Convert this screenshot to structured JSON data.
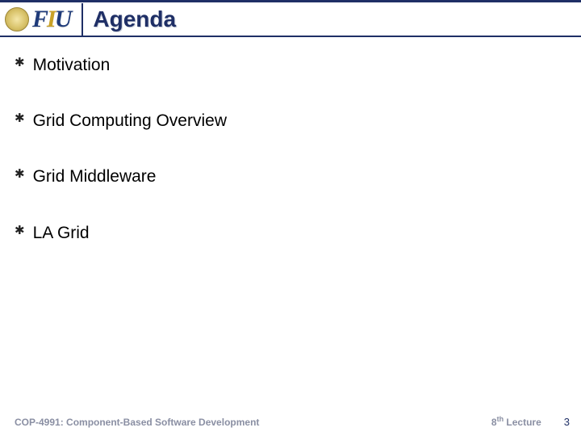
{
  "header": {
    "logo_letters": {
      "f": "F",
      "i": "I",
      "u": "U"
    },
    "title": "Agenda"
  },
  "bullets": [
    {
      "text": "Motivation"
    },
    {
      "text": "Grid Computing Overview"
    },
    {
      "text": "Grid Middleware"
    },
    {
      "text": "LA Grid"
    }
  ],
  "footer": {
    "course": "COP-4991: Component-Based Software Development",
    "lecture_num": "8",
    "lecture_suffix": "th",
    "lecture_word": " Lecture",
    "page": "3"
  },
  "icons": {
    "bullet_glyph": "✱"
  },
  "colors": {
    "accent": "#1f2f66",
    "gold": "#c9a227",
    "muted": "#8a8fa3"
  }
}
